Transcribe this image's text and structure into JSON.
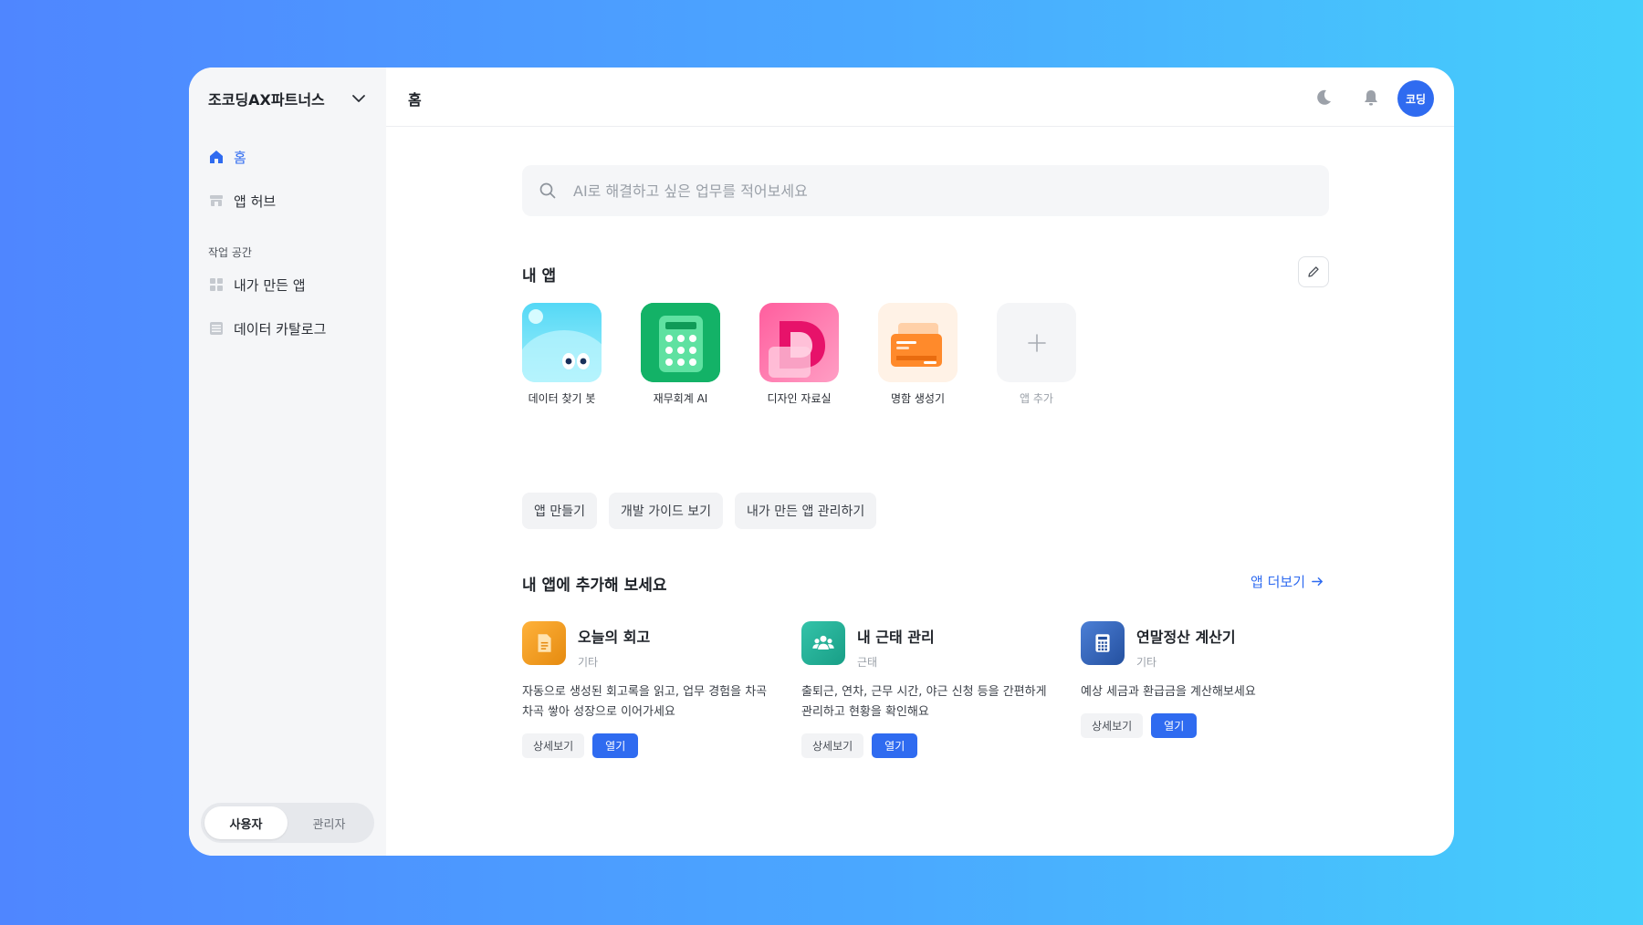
{
  "sidebar": {
    "org_name": "조코딩AX파트너스",
    "items": [
      {
        "label": "홈"
      },
      {
        "label": "앱 허브"
      }
    ],
    "workspace_label": "작업 공간",
    "workspace_items": [
      {
        "label": "내가 만든 앱"
      },
      {
        "label": "데이터 카탈로그"
      }
    ],
    "roles": {
      "user": "사용자",
      "admin": "관리자"
    }
  },
  "header": {
    "title": "홈",
    "avatar_text": "코딩"
  },
  "search": {
    "placeholder": "AI로 해결하고 싶은 업무를 적어보세요"
  },
  "my_apps": {
    "title": "내 앱",
    "apps": [
      {
        "label": "데이터 찾기 봇"
      },
      {
        "label": "재무회계 AI"
      },
      {
        "label": "디자인 자료실"
      },
      {
        "label": "명함 생성기"
      },
      {
        "label": "앱 추가"
      }
    ]
  },
  "chips": [
    "앱 만들기",
    "개발 가이드 보기",
    "내가 만든 앱 관리하기"
  ],
  "recommend": {
    "title": "내 앱에 추가해 보세요",
    "more_label": "앱 더보기",
    "detail_label": "상세보기",
    "open_label": "열기",
    "cards": [
      {
        "title": "오늘의 회고",
        "category": "기타",
        "description": "자동으로 생성된 회고록을 읽고, 업무 경험을 차곡차곡 쌓아 성장으로 이어가세요"
      },
      {
        "title": "내 근태 관리",
        "category": "근태",
        "description": "출퇴근, 연차, 근무 시간, 야근 신청 등을 간편하게 관리하고 현황을 확인해요"
      },
      {
        "title": "연말정산 계산기",
        "category": "기타",
        "description": "예상 세금과 환급금을 계산해보세요"
      }
    ]
  },
  "colors": {
    "accent": "#2f6bf0",
    "sidebar_bg": "#f5f6f8"
  }
}
